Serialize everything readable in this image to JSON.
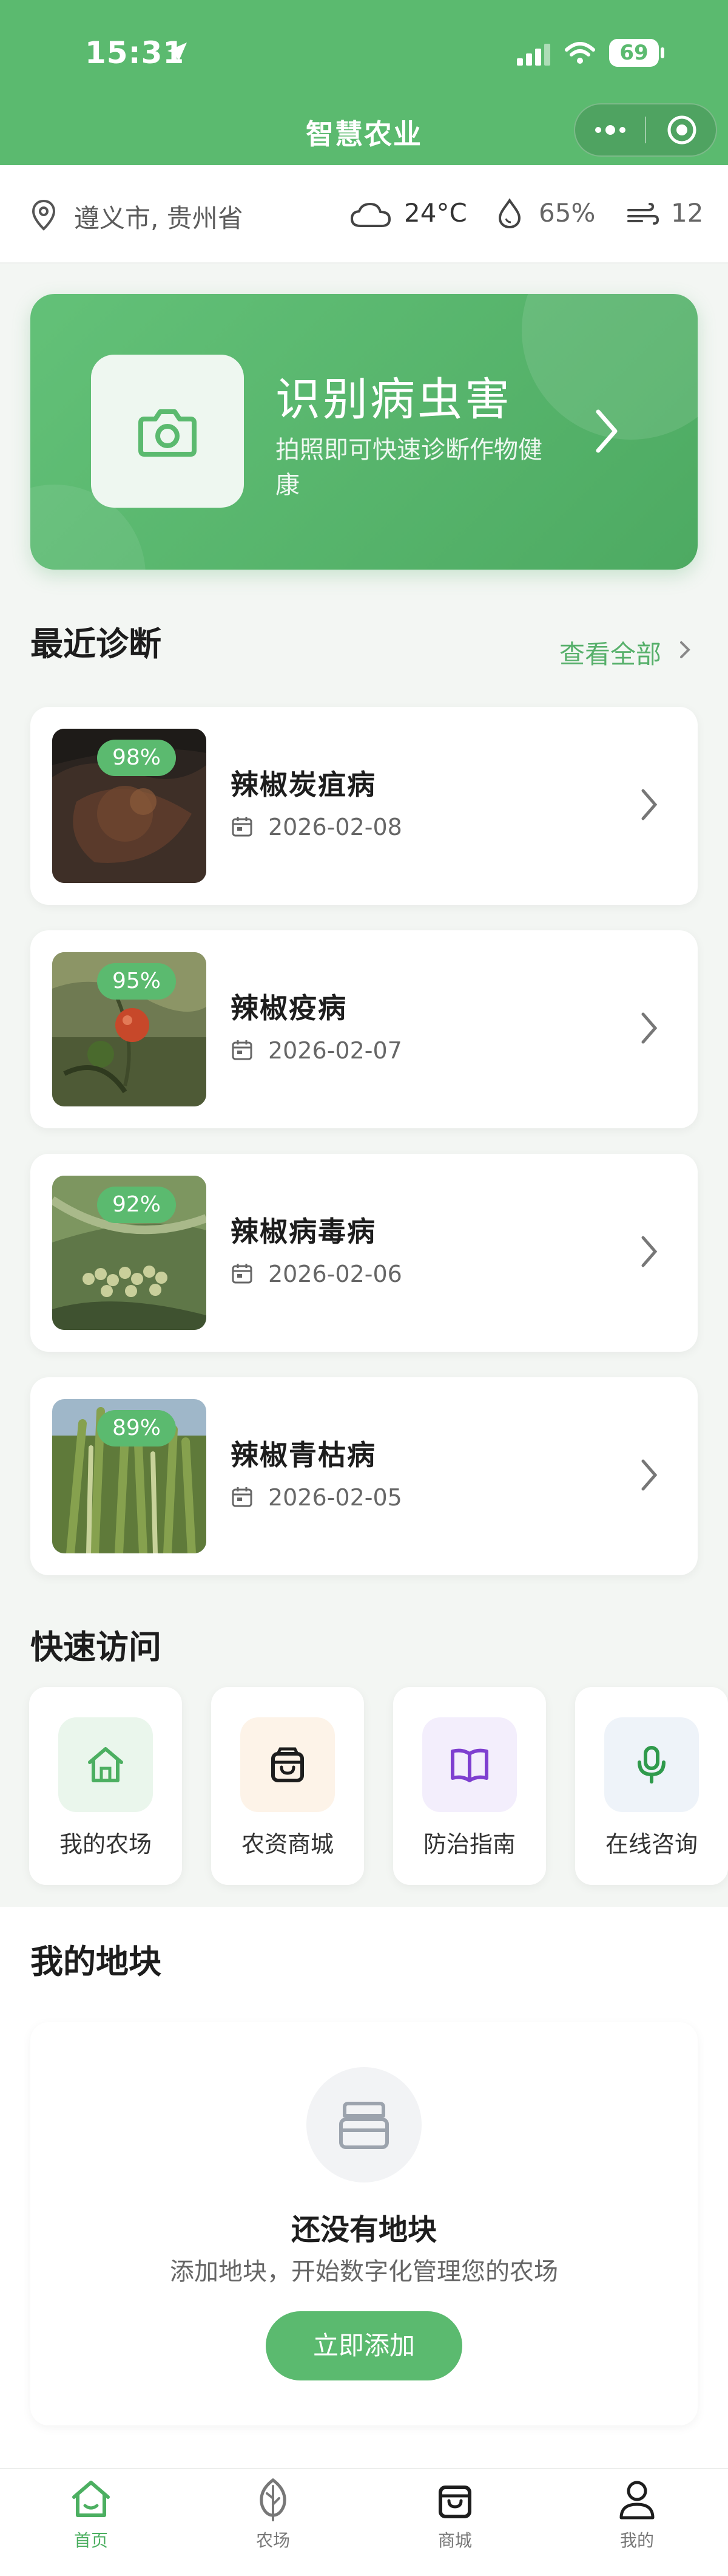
{
  "status_bar": {
    "time": "15:31",
    "battery": "69"
  },
  "nav": {
    "title": "智慧农业"
  },
  "info_bar": {
    "location": "遵义市, 贵州省",
    "temperature": "24°C",
    "humidity": "65%",
    "wind": "12"
  },
  "hero": {
    "title": "识别病虫害",
    "subtitle": "拍照即可快速诊断作物健康"
  },
  "recent": {
    "title": "最近诊断",
    "see_all": "查看全部",
    "items": [
      {
        "name": "辣椒炭疽病",
        "date": "2026-02-08",
        "confidence": "98%"
      },
      {
        "name": "辣椒疫病",
        "date": "2026-02-07",
        "confidence": "95%"
      },
      {
        "name": "辣椒病毒病",
        "date": "2026-02-06",
        "confidence": "92%"
      },
      {
        "name": "辣椒青枯病",
        "date": "2026-02-05",
        "confidence": "89%"
      }
    ]
  },
  "quick_access": {
    "title": "快速访问",
    "items": [
      {
        "label": "我的农场",
        "icon": "home-icon",
        "color": "#4caf61"
      },
      {
        "label": "农资商城",
        "icon": "shopping-bag-icon",
        "color": "#1d1d1d"
      },
      {
        "label": "防治指南",
        "icon": "book-icon",
        "color": "#7e3fd0"
      },
      {
        "label": "在线咨询",
        "icon": "microphone-icon",
        "color": "#2f9a4c"
      }
    ]
  },
  "plots": {
    "title": "我的地块",
    "empty_title": "还没有地块",
    "empty_subtitle": "添加地块，开始数字化管理您的农场",
    "add_button": "立即添加"
  },
  "tab_bar": {
    "items": [
      {
        "label": "首页",
        "icon": "home-icon",
        "active": true
      },
      {
        "label": "农场",
        "icon": "leaf-icon",
        "active": false
      },
      {
        "label": "商城",
        "icon": "shopping-bag-icon",
        "active": false
      },
      {
        "label": "我的",
        "icon": "user-icon",
        "active": false
      }
    ]
  },
  "colors": {
    "primary": "#5bba6f",
    "text": "#1d1d1d",
    "muted": "#666666"
  }
}
